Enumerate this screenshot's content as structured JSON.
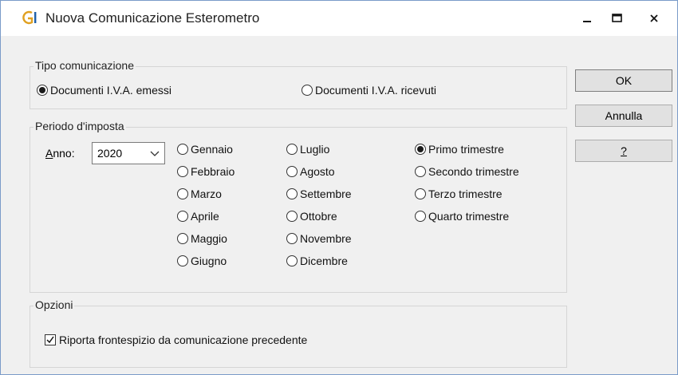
{
  "window": {
    "title": "Nuova Comunicazione Esterometro",
    "controls": {
      "minimize": "minimize",
      "maximize": "maximize",
      "close": "close"
    }
  },
  "tipo": {
    "legend": "Tipo comunicazione",
    "options": [
      {
        "label": "Documenti I.V.A. emessi",
        "selected": true
      },
      {
        "label": "Documenti I.V.A. ricevuti",
        "selected": false
      }
    ]
  },
  "periodo": {
    "legend": "Periodo d'imposta",
    "anno_label_first": "A",
    "anno_label_rest": "nno:",
    "anno_value": "2020",
    "months_col1": [
      "Gennaio",
      "Febbraio",
      "Marzo",
      "Aprile",
      "Maggio",
      "Giugno"
    ],
    "months_col2": [
      "Luglio",
      "Agosto",
      "Settembre",
      "Ottobre",
      "Novembre",
      "Dicembre"
    ],
    "quarters": [
      "Primo trimestre",
      "Secondo trimestre",
      "Terzo trimestre",
      "Quarto trimestre"
    ],
    "selected": "Primo trimestre"
  },
  "opzioni": {
    "legend": "Opzioni",
    "checkbox_label": "Riporta frontespizio da comunicazione precedente",
    "checked": true
  },
  "buttons": {
    "ok": "OK",
    "annulla": "Annulla",
    "help": "?"
  }
}
